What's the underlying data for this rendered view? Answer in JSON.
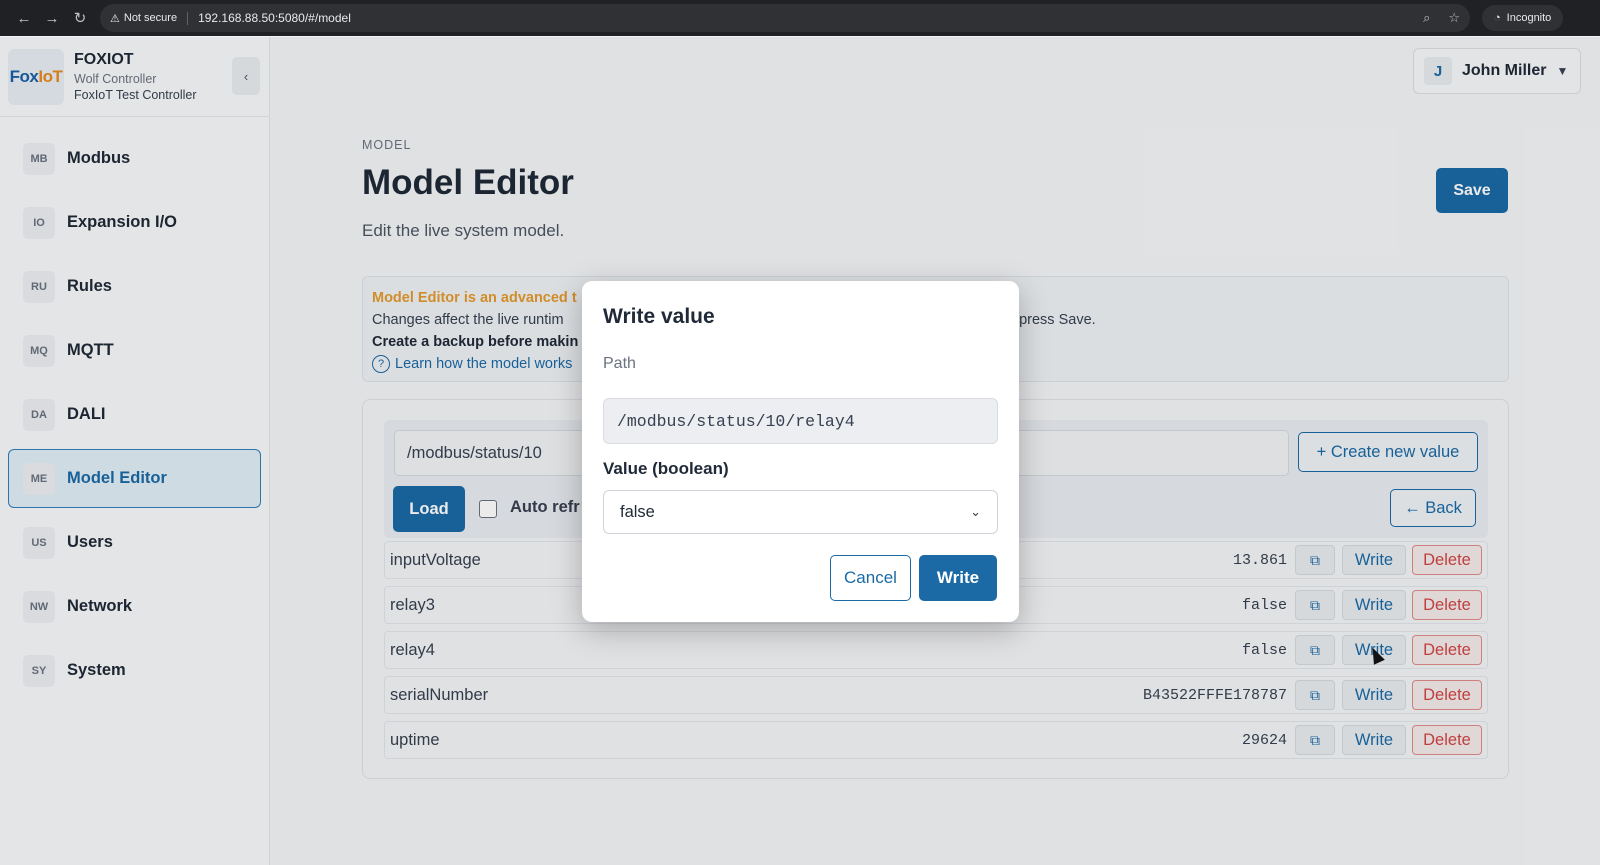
{
  "browser": {
    "security_label": "Not secure",
    "url": "192.168.88.50:5080/#/model",
    "incognito_label": "Incognito"
  },
  "brand": {
    "logo_text_a": "Fox",
    "logo_text_b": "IoT",
    "name": "FOXIOT",
    "subtitle": "Wolf Controller",
    "controller": "FoxIoT Test Controller",
    "collapse_icon": "‹"
  },
  "sidebar": {
    "items": [
      {
        "abbr": "MB",
        "label": "Modbus"
      },
      {
        "abbr": "IO",
        "label": "Expansion I/O"
      },
      {
        "abbr": "RU",
        "label": "Rules"
      },
      {
        "abbr": "MQ",
        "label": "MQTT"
      },
      {
        "abbr": "DA",
        "label": "DALI"
      },
      {
        "abbr": "ME",
        "label": "Model Editor"
      },
      {
        "abbr": "US",
        "label": "Users"
      },
      {
        "abbr": "NW",
        "label": "Network"
      },
      {
        "abbr": "SY",
        "label": "System"
      }
    ],
    "active_index": 5
  },
  "user": {
    "initial": "J",
    "name": "John Miller"
  },
  "page": {
    "breadcrumb": "MODEL",
    "title": "Model Editor",
    "subtitle": "Edit the live system model.",
    "save_label": "Save"
  },
  "warning": {
    "title": "Model Editor is an advanced t",
    "line1": "Changes affect the live runtim",
    "line1_right": "u press Save.",
    "line2": "Create a backup before makin",
    "link": "Learn how the model works"
  },
  "toolbar": {
    "path_value": "/modbus/status/10",
    "create_label": "+ Create new value",
    "load_label": "Load",
    "auto_refresh_label": "Auto refr",
    "back_label": "← Back"
  },
  "rows": [
    {
      "key": "inputVoltage",
      "value": "13.861"
    },
    {
      "key": "relay3",
      "value": "false"
    },
    {
      "key": "relay4",
      "value": "false"
    },
    {
      "key": "serialNumber",
      "value": "B43522FFFE178787"
    },
    {
      "key": "uptime",
      "value": "29624"
    }
  ],
  "row_actions": {
    "copy_icon": "⧉",
    "write_label": "Write",
    "delete_label": "Delete"
  },
  "modal": {
    "title": "Write value",
    "path_label": "Path",
    "path_value": "/modbus/status/10/relay4",
    "value_label": "Value (boolean)",
    "selected_value": "false",
    "cancel_label": "Cancel",
    "write_label": "Write"
  },
  "colors": {
    "accent": "#1b6aa5",
    "warning_title": "#e39a2d",
    "delete": "#d04545"
  }
}
